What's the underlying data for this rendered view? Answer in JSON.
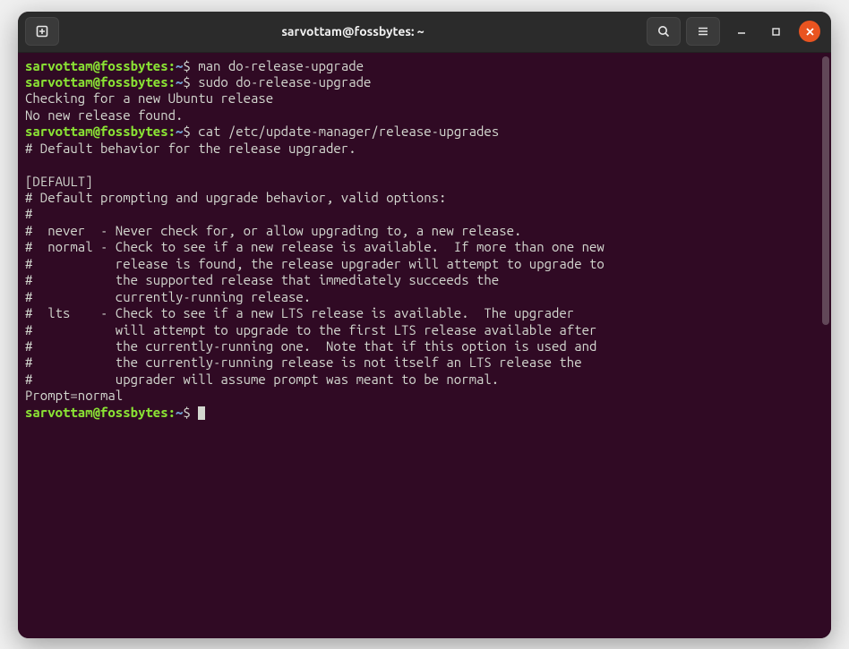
{
  "window": {
    "title": "sarvottam@fossbytes: ~"
  },
  "prompt": {
    "user_host": "sarvottam@fossbytes",
    "colon": ":",
    "path": "~",
    "dollar": "$"
  },
  "commands": {
    "cmd1": " man do-release-upgrade",
    "cmd2": " sudo do-release-upgrade",
    "cmd3": " cat /etc/update-manager/release-upgrades",
    "cmd4": " "
  },
  "output": {
    "line1": "Checking for a new Ubuntu release",
    "line2": "No new release found.",
    "file": {
      "l1": "# Default behavior for the release upgrader.",
      "l2": "",
      "l3": "[DEFAULT]",
      "l4": "# Default prompting and upgrade behavior, valid options:",
      "l5": "#",
      "l6": "#  never  - Never check for, or allow upgrading to, a new release.",
      "l7": "#  normal - Check to see if a new release is available.  If more than one new",
      "l8": "#           release is found, the release upgrader will attempt to upgrade to",
      "l9": "#           the supported release that immediately succeeds the",
      "l10": "#           currently-running release.",
      "l11": "#  lts    - Check to see if a new LTS release is available.  The upgrader",
      "l12": "#           will attempt to upgrade to the first LTS release available after",
      "l13": "#           the currently-running one.  Note that if this option is used and",
      "l14": "#           the currently-running release is not itself an LTS release the",
      "l15": "#           upgrader will assume prompt was meant to be normal.",
      "l16": "Prompt=normal"
    }
  }
}
